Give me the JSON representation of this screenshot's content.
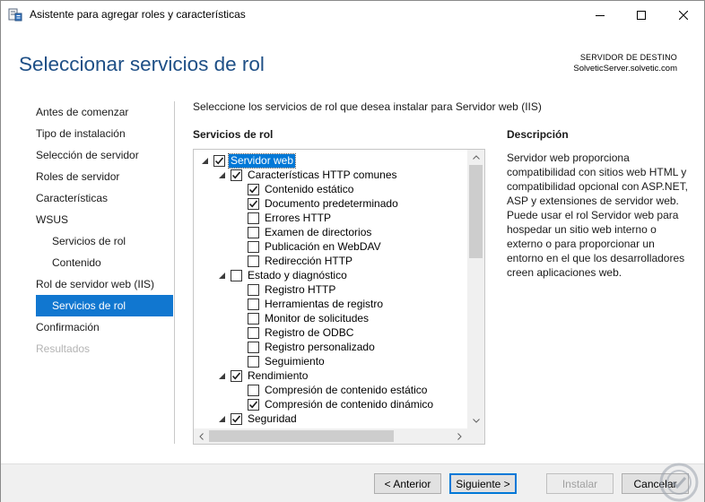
{
  "window": {
    "title": "Asistente para agregar roles y características",
    "icon": "server-manager-icon"
  },
  "header": {
    "title": "Seleccionar servicios de rol",
    "destination_label": "SERVIDOR DE DESTINO",
    "destination_server": "SolveticServer.solvetic.com"
  },
  "nav": {
    "items": [
      {
        "label": "Antes de comenzar",
        "state": "normal"
      },
      {
        "label": "Tipo de instalación",
        "state": "normal"
      },
      {
        "label": "Selección de servidor",
        "state": "normal"
      },
      {
        "label": "Roles de servidor",
        "state": "normal"
      },
      {
        "label": "Características",
        "state": "normal"
      },
      {
        "label": "WSUS",
        "state": "normal"
      },
      {
        "label": "Servicios de rol",
        "state": "normal",
        "sub": true
      },
      {
        "label": "Contenido",
        "state": "normal",
        "sub": true
      },
      {
        "label": "Rol de servidor web (IIS)",
        "state": "normal"
      },
      {
        "label": "Servicios de rol",
        "state": "active",
        "sub": true
      },
      {
        "label": "Confirmación",
        "state": "normal"
      },
      {
        "label": "Resultados",
        "state": "disabled"
      }
    ]
  },
  "main": {
    "instruction": "Seleccione los servicios de rol que desea instalar para Servidor web (IIS)",
    "services_heading": "Servicios de rol",
    "description_heading": "Descripción",
    "description_text": "Servidor web proporciona compatibilidad con sitios web HTML y compatibilidad opcional con ASP.NET, ASP y extensiones de servidor web. Puede usar el rol Servidor web para hospedar un sitio web interno o externo o para proporcionar un entorno en el que los desarrolladores creen aplicaciones web."
  },
  "tree": [
    {
      "label": "Servidor web",
      "level": 0,
      "expandable": true,
      "checked": true,
      "selected": true
    },
    {
      "label": "Características HTTP comunes",
      "level": 1,
      "expandable": true,
      "checked": true
    },
    {
      "label": "Contenido estático",
      "level": 2,
      "expandable": false,
      "checked": true
    },
    {
      "label": "Documento predeterminado",
      "level": 2,
      "expandable": false,
      "checked": true
    },
    {
      "label": "Errores HTTP",
      "level": 2,
      "expandable": false,
      "checked": false
    },
    {
      "label": "Examen de directorios",
      "level": 2,
      "expandable": false,
      "checked": false
    },
    {
      "label": "Publicación en WebDAV",
      "level": 2,
      "expandable": false,
      "checked": false
    },
    {
      "label": "Redirección HTTP",
      "level": 2,
      "expandable": false,
      "checked": false
    },
    {
      "label": "Estado y diagnóstico",
      "level": 1,
      "expandable": true,
      "checked": false
    },
    {
      "label": "Registro HTTP",
      "level": 2,
      "expandable": false,
      "checked": false
    },
    {
      "label": "Herramientas de registro",
      "level": 2,
      "expandable": false,
      "checked": false
    },
    {
      "label": "Monitor de solicitudes",
      "level": 2,
      "expandable": false,
      "checked": false
    },
    {
      "label": "Registro de ODBC",
      "level": 2,
      "expandable": false,
      "checked": false
    },
    {
      "label": "Registro personalizado",
      "level": 2,
      "expandable": false,
      "checked": false
    },
    {
      "label": "Seguimiento",
      "level": 2,
      "expandable": false,
      "checked": false
    },
    {
      "label": "Rendimiento",
      "level": 1,
      "expandable": true,
      "checked": true
    },
    {
      "label": "Compresión de contenido estático",
      "level": 2,
      "expandable": false,
      "checked": false
    },
    {
      "label": "Compresión de contenido dinámico",
      "level": 2,
      "expandable": false,
      "checked": true
    },
    {
      "label": "Seguridad",
      "level": 1,
      "expandable": true,
      "checked": true
    }
  ],
  "footer": {
    "prev_label": "< Anterior",
    "next_label": "Siguiente >",
    "install_label": "Instalar",
    "cancel_label": "Cancelar"
  },
  "colors": {
    "title_blue": "#1e4f86",
    "nav_active": "#1177d0",
    "selection": "#0078d7"
  }
}
